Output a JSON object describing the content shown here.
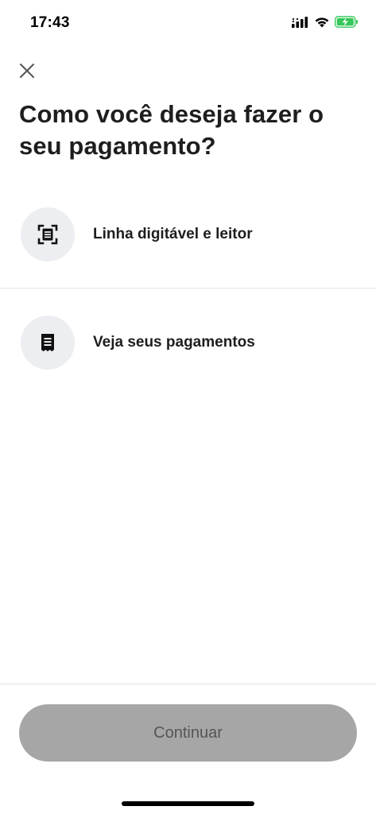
{
  "status_bar": {
    "time": "17:43",
    "icons": [
      "signal-icon",
      "wifi-icon",
      "battery-charging-icon"
    ],
    "battery_color": "#34c759"
  },
  "header": {
    "close_icon": "close-icon",
    "title": "Como você deseja fazer o seu pagamento?"
  },
  "options": [
    {
      "icon": "barcode-scanner-icon",
      "label": "Linha digitável e leitor"
    },
    {
      "icon": "receipt-icon",
      "label": "Veja seus pagamentos"
    }
  ],
  "footer": {
    "continue_label": "Continuar",
    "continue_enabled": false,
    "button_color": "#a6a6a6"
  }
}
